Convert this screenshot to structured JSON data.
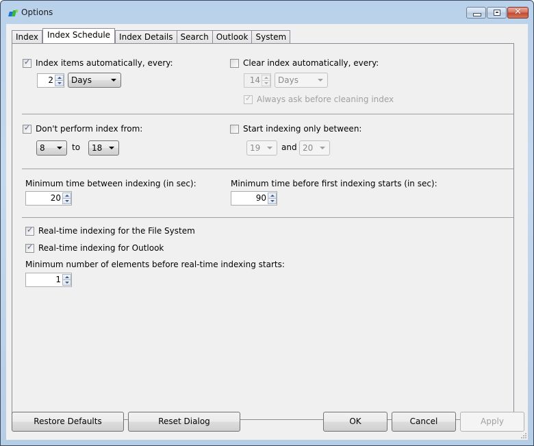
{
  "window": {
    "title": "Options",
    "app_icon": "app-logo-icon",
    "caption_buttons": {
      "minimize": "minimize-icon",
      "maximize": "maximize-icon",
      "close": "close-icon",
      "close_glyph": "✕"
    }
  },
  "tabs": [
    {
      "label": "Index",
      "active": false
    },
    {
      "label": "Index Schedule",
      "active": true
    },
    {
      "label": "Index Details",
      "active": false
    },
    {
      "label": "Search",
      "active": false
    },
    {
      "label": "Outlook",
      "active": false
    },
    {
      "label": "System",
      "active": false
    }
  ],
  "schedule": {
    "index_auto": {
      "label": "Index items automatically, every:",
      "checked": true,
      "interval_value": "2",
      "interval_unit": "Days"
    },
    "clear_auto": {
      "label": "Clear index automatically, every:",
      "checked": false,
      "interval_value": "14",
      "interval_unit": "Days",
      "ask_label": "Always ask before cleaning index",
      "ask_checked": true
    },
    "dont_perform": {
      "label": "Don't perform index from:",
      "checked": true,
      "from": "8",
      "to_label": "to",
      "to": "18"
    },
    "start_between": {
      "label": "Start indexing only between:",
      "checked": false,
      "from": "19",
      "and_label": "and",
      "to": "20"
    },
    "min_between": {
      "label": "Minimum time between indexing (in sec):",
      "value": "20"
    },
    "min_before_first": {
      "label": "Minimum time before first indexing starts (in sec):",
      "value": "90"
    },
    "realtime_fs": {
      "label": "Real-time indexing for the File System",
      "checked": true
    },
    "realtime_outlook": {
      "label": "Real-time indexing for Outlook",
      "checked": true
    },
    "min_elements": {
      "label": "Minimum number of elements before real-time indexing starts:",
      "value": "1"
    }
  },
  "buttons": {
    "restore_defaults": "Restore Defaults",
    "reset_dialog": "Reset Dialog",
    "ok": "OK",
    "cancel": "Cancel",
    "apply": "Apply"
  }
}
